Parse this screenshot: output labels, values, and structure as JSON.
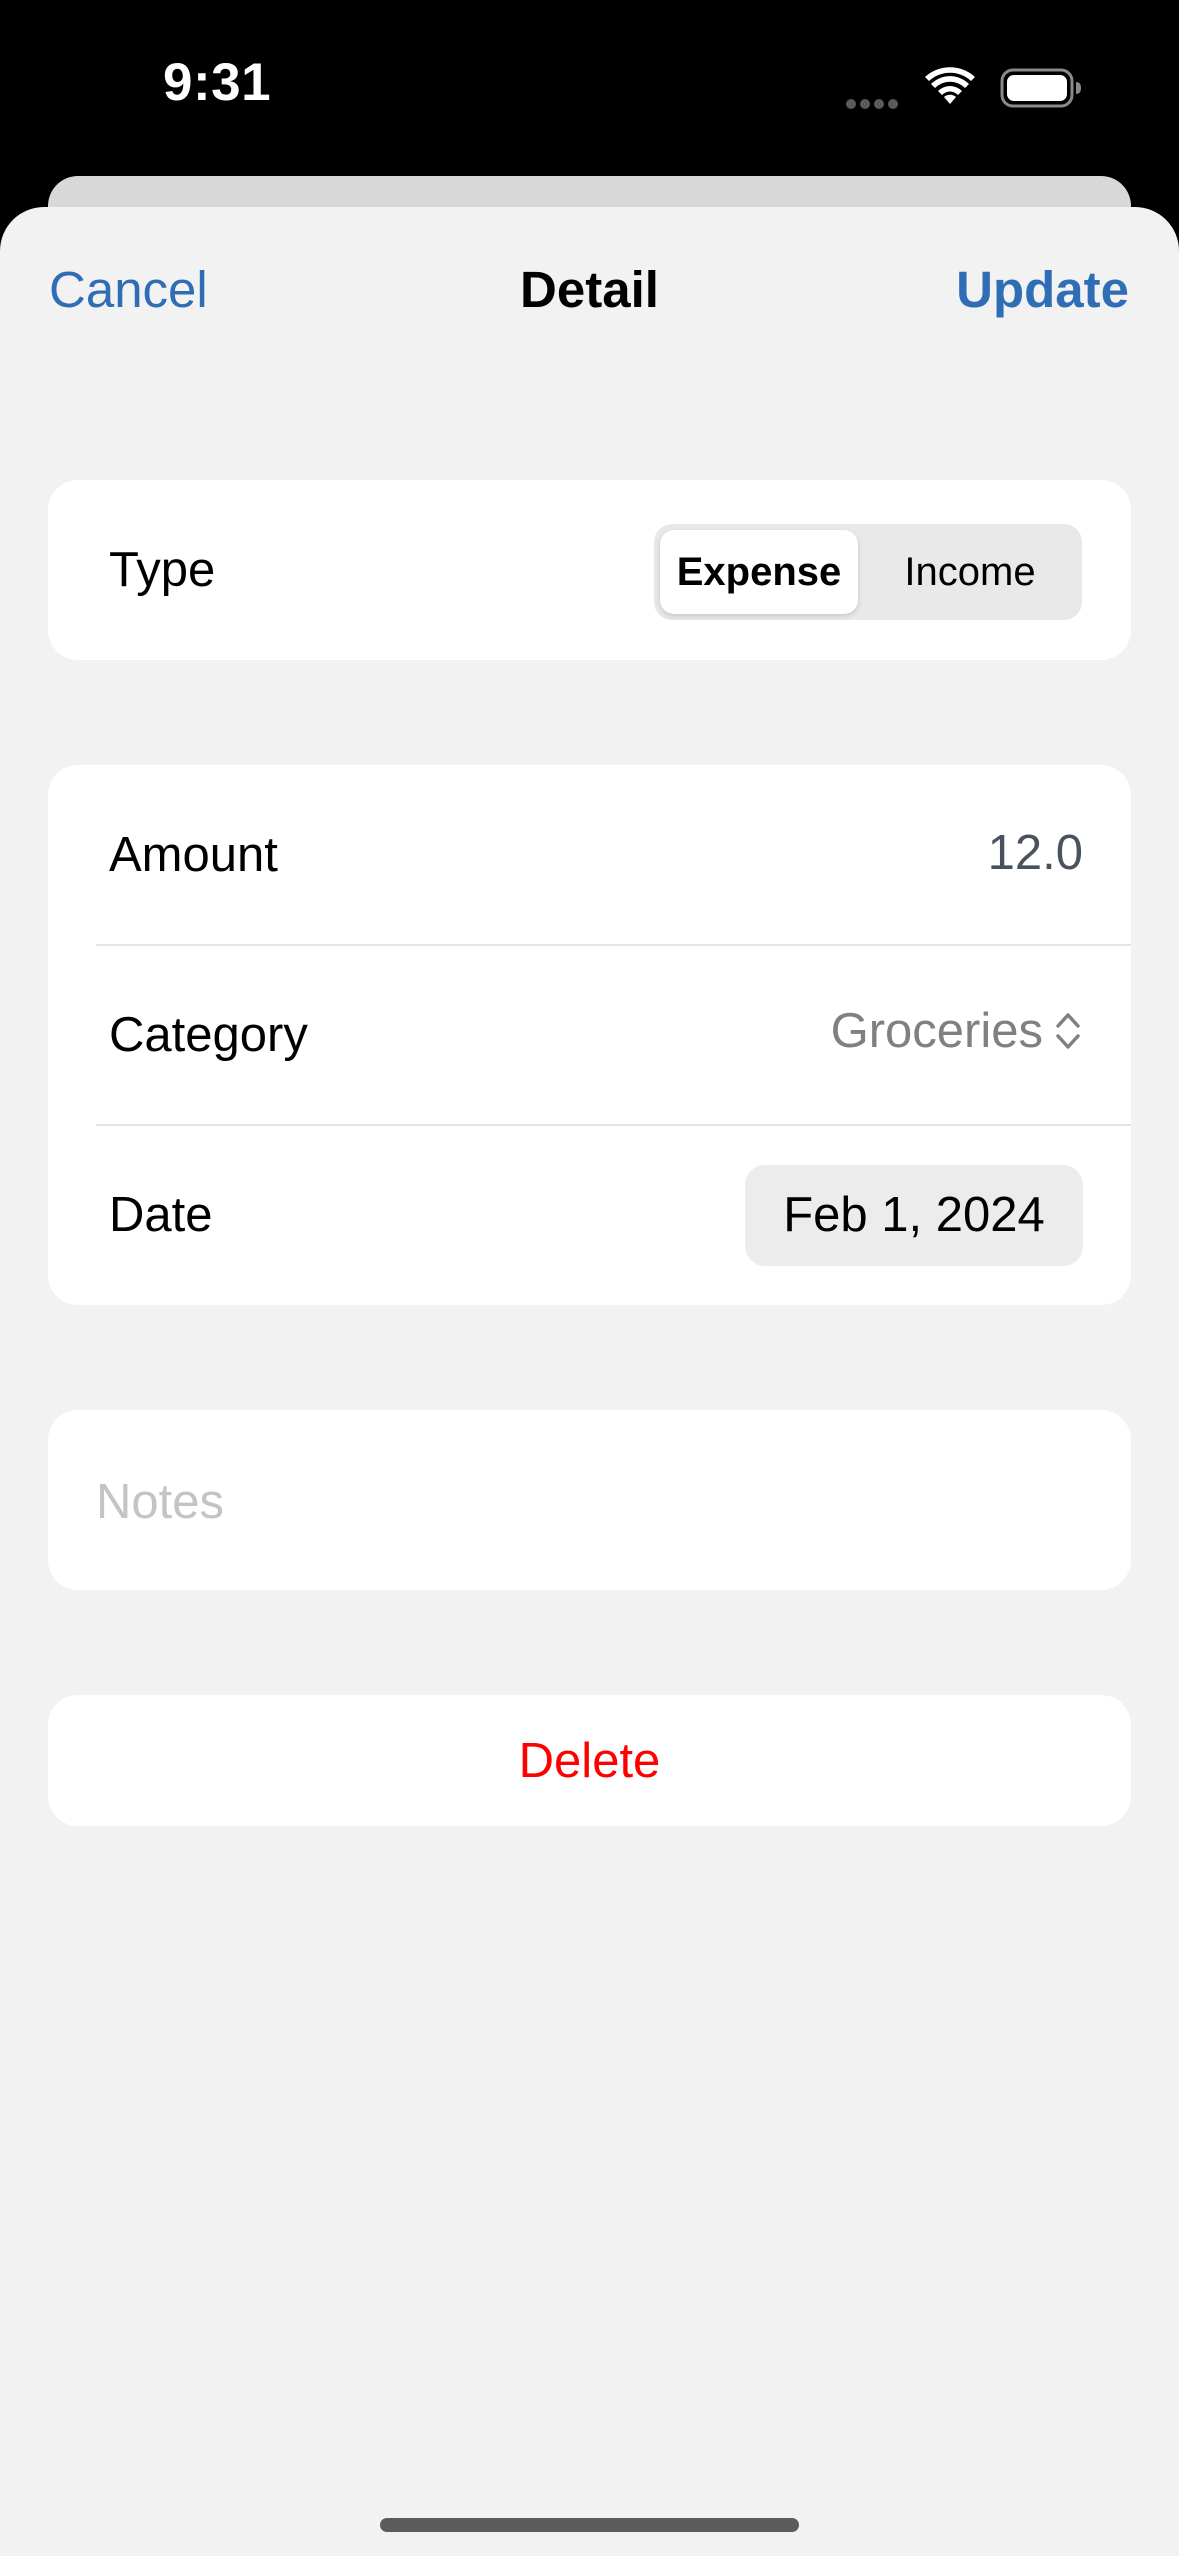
{
  "status_bar": {
    "time": "9:31"
  },
  "nav": {
    "cancel_label": "Cancel",
    "title": "Detail",
    "update_label": "Update"
  },
  "type_row": {
    "label": "Type",
    "options": [
      "Expense",
      "Income"
    ],
    "selected": "Expense"
  },
  "details": {
    "amount_label": "Amount",
    "amount_value": "12.0",
    "category_label": "Category",
    "category_value": "Groceries",
    "date_label": "Date",
    "date_value": "Feb 1, 2024"
  },
  "notes": {
    "placeholder": "Notes"
  },
  "delete_label": "Delete",
  "colors": {
    "accent": "#2f6db5",
    "destructive": "#ff0000",
    "sheet_background": "#f2f2f2",
    "status_bar_background": "#000000"
  },
  "icons": {
    "wifi": "wifi-icon",
    "battery": "battery-icon",
    "category_chevron": "chevron-up-down-icon"
  }
}
